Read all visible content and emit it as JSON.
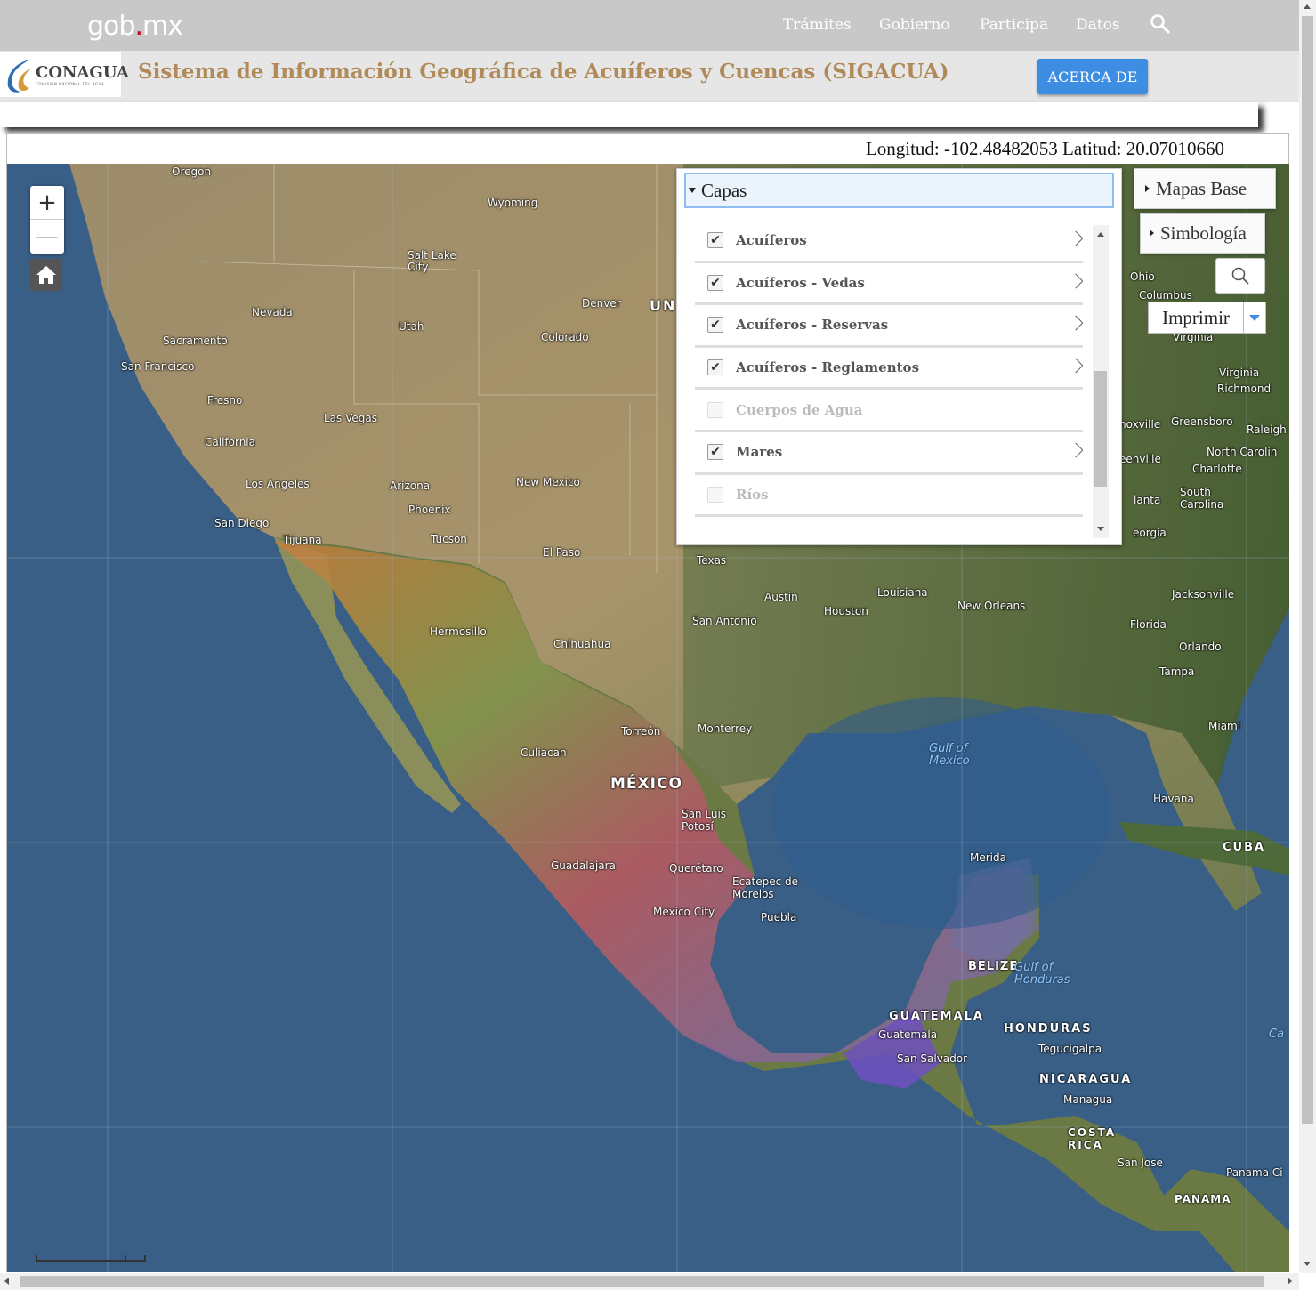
{
  "gob": {
    "logo_main": "gob",
    "logo_dot": ".",
    "logo_tld": "mx",
    "nav": [
      "Trámites",
      "Gobierno",
      "Participa",
      "Datos"
    ],
    "search_icon": "search-icon"
  },
  "header": {
    "logo_word": "CONAGUA",
    "logo_sub": "COMISIÓN NACIONAL DEL AGUA",
    "title": "Sistema de Información Geográfica de Acuíferos y Cuencas (SIGACUA)",
    "about_label": "ACERCA DE"
  },
  "map": {
    "coords": "Longitud: -102.48482053 Latitud: 20.07010660",
    "zoom_in": "+",
    "zoom_out": "—",
    "home_icon": "home-icon",
    "colors": {
      "ocean": "#3a5f86",
      "land": "#8b7a5a",
      "accent": "#3d8ee3"
    }
  },
  "layers": {
    "title": "Capas",
    "items": [
      {
        "name": "Acuíferos",
        "checked": true
      },
      {
        "name": "Acuíferos - Vedas",
        "checked": true
      },
      {
        "name": "Acuíferos - Reservas",
        "checked": true
      },
      {
        "name": "Acuíferos - Reglamentos",
        "checked": true
      },
      {
        "name": "Cuerpos de Agua",
        "checked": false
      },
      {
        "name": "Mares",
        "checked": true
      },
      {
        "name": "Ríos",
        "checked": false
      }
    ]
  },
  "widgets": {
    "base_maps": "Mapas Base",
    "symbology": "Simbología",
    "print": "Imprimir"
  },
  "labels": {
    "oregon": "Oregon",
    "wyoming": "Wyoming",
    "salt_lake": "Salt Lake City",
    "nevada": "Nevada",
    "utah": "Utah",
    "denver": "Denver",
    "colorado": "Colorado",
    "un": "UN",
    "sacramento": "Sacramento",
    "san_francisco": "San Francisco",
    "fresno": "Fresno",
    "las_vegas": "Las Vegas",
    "california": "California",
    "los_angeles": "Los Angeles",
    "arizona": "Arizona",
    "new_mexico": "New Mexico",
    "phoenix": "Phoenix",
    "san_diego": "San Diego",
    "tijuana": "Tijuana",
    "tucson": "Tucson",
    "el_paso": "El Paso",
    "texas": "Texas",
    "austin": "Austin",
    "louisiana": "Louisiana",
    "houston": "Houston",
    "new_orleans": "New Orleans",
    "jacksonville": "Jacksonville",
    "san_antonio": "San Antonio",
    "hermosillo": "Hermosillo",
    "chihuahua": "Chihuahua",
    "florida": "Florida",
    "orlando": "Orlando",
    "tampa": "Tampa",
    "torreon": "Torreón",
    "monterrey": "Monterrey",
    "miami": "Miami",
    "culiacan": "Culiacan",
    "mexico": "MÉXICO",
    "gulf_mexico": "Gulf of Mexico",
    "san_luis": "San Luis Potosí",
    "havana": "Havana",
    "cuba": "CUBA",
    "guadalajara": "Guadalajara",
    "queretaro": "Querétaro",
    "merida": "Merida",
    "ecatepec": "Ecatepec de Morelos",
    "mexico_city": "Mexico City",
    "puebla": "Puebla",
    "belize": "BELIZE",
    "gulf_honduras": "Gulf of Honduras",
    "guatemala_c": "GUATEMALA",
    "honduras": "HONDURAS",
    "guatemala": "Guatemala",
    "tegucigalpa": "Tegucigalpa",
    "san_salvador": "San Salvador",
    "nicaragua": "NICARAGUA",
    "managua": "Managua",
    "costa_rica": "COSTA RICA",
    "san_jose": "San Jose",
    "panama": "PANAMA",
    "panama_city": "Panama Ci",
    "ohio": "Ohio",
    "columbus": "Columbus",
    "virginia": "Virginia",
    "virginia2": "Virginia",
    "richmond": "Richmond",
    "knoxville": "noxville",
    "greensboro": "Greensboro",
    "raleigh": "Raleigh",
    "greenville": "eenville",
    "north_carolina": "North Carolin",
    "charlotte": "Charlotte",
    "south_carolina": "South Carolina",
    "atlanta": "lanta",
    "georgia": "eorgia",
    "ca_partial": "Ca"
  }
}
